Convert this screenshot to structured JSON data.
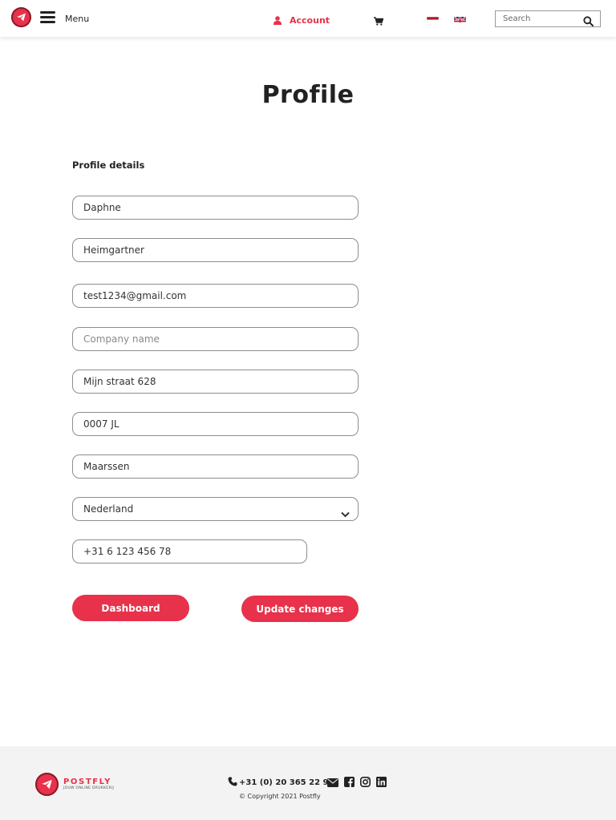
{
  "header": {
    "menu_label": "Menu",
    "account_label": "Account",
    "search_placeholder": "Search",
    "flags": [
      "nl-flag",
      "uk-flag"
    ]
  },
  "page": {
    "title": "Profile",
    "section_title": "Profile details"
  },
  "form": {
    "first_name": "Daphne",
    "last_name": "Heimgartner",
    "email": "test1234@gmail.com",
    "company_placeholder": "Company name",
    "street": "Mijn straat 628",
    "postcode": "0007 JL",
    "city": "Maarssen",
    "country": "Nederland",
    "phone": "+31 6 123 456 78"
  },
  "buttons": {
    "dashboard": "Dashboard",
    "update": "Update changes"
  },
  "footer": {
    "brand": "POSTFLY",
    "tagline": "JOUW ONLINE DRUKKERIJ",
    "phone": "+31 (0) 20 365 22 93",
    "copyright": "© Copyright 2021 Postfly"
  },
  "colors": {
    "accent": "#e8314a",
    "footer_bg": "#f3f3f3"
  }
}
